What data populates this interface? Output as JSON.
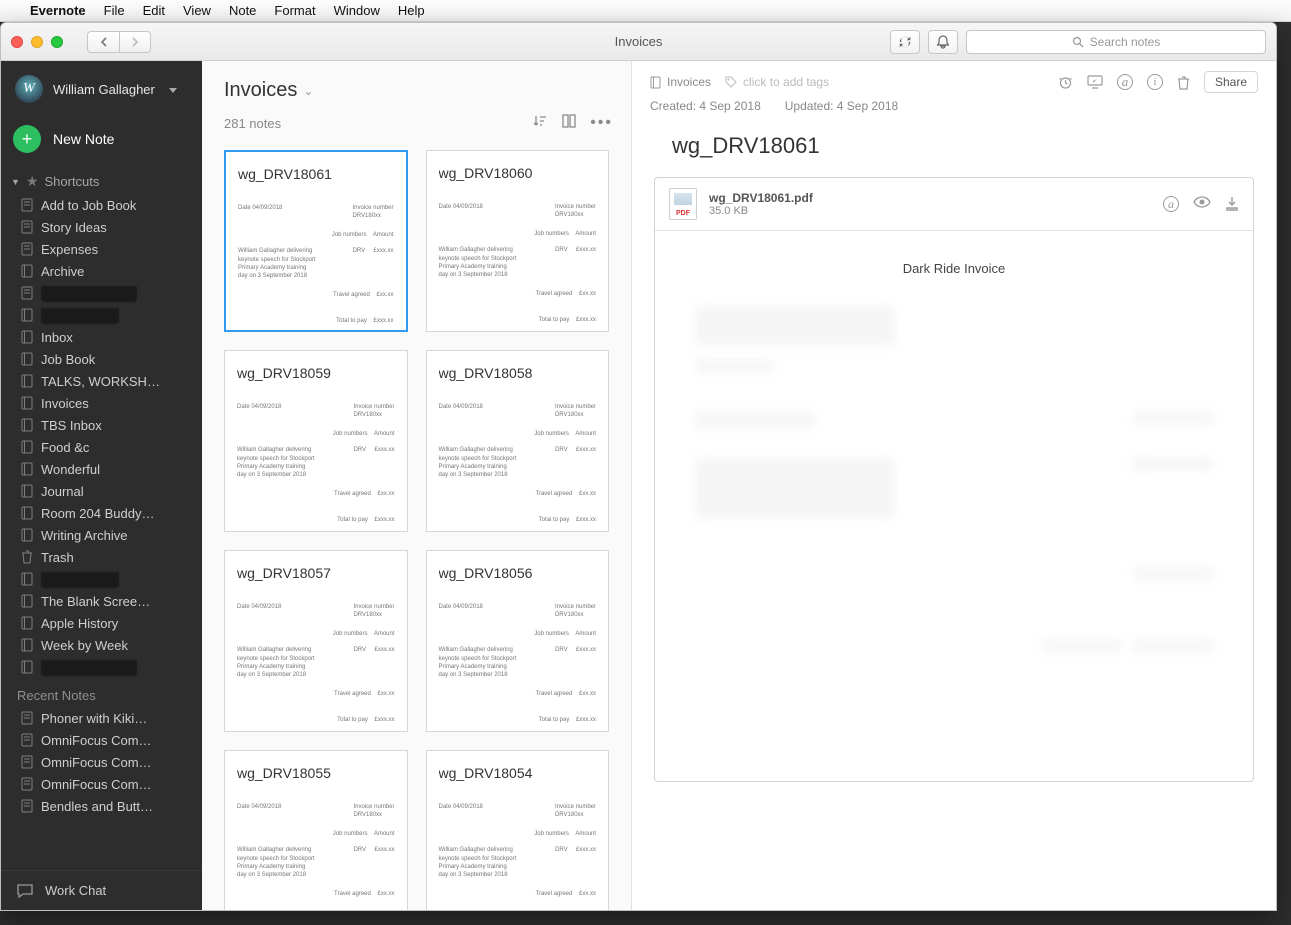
{
  "menubar": {
    "app": "Evernote",
    "items": [
      "File",
      "Edit",
      "View",
      "Note",
      "Format",
      "Window",
      "Help"
    ]
  },
  "window": {
    "title": "Invoices",
    "search_placeholder": "Search notes"
  },
  "sidebar": {
    "user": "William Gallagher",
    "new_note": "New Note",
    "shortcuts_label": "Shortcuts",
    "shortcuts": [
      {
        "label": "Add to Job Book",
        "icon": "note"
      },
      {
        "label": "Story Ideas",
        "icon": "note"
      },
      {
        "label": "Expenses",
        "icon": "note"
      },
      {
        "label": "Archive",
        "icon": "notebook"
      },
      {
        "label": "██████████",
        "icon": "note",
        "redacted": true
      },
      {
        "label": "████████",
        "icon": "notebook",
        "redacted": true
      },
      {
        "label": "Inbox",
        "icon": "notebook"
      },
      {
        "label": "Job Book",
        "icon": "notebook"
      },
      {
        "label": "TALKS, WORKSH…",
        "icon": "notebook"
      },
      {
        "label": "Invoices",
        "icon": "notebook"
      },
      {
        "label": "TBS Inbox",
        "icon": "notebook"
      },
      {
        "label": "Food &c",
        "icon": "notebook"
      },
      {
        "label": "Wonderful",
        "icon": "notebook"
      },
      {
        "label": "Journal",
        "icon": "notebook"
      },
      {
        "label": "Room 204 Buddy…",
        "icon": "notebook"
      },
      {
        "label": "Writing Archive",
        "icon": "notebook"
      },
      {
        "label": "Trash",
        "icon": "trash"
      },
      {
        "label": "████████",
        "icon": "notebook",
        "redacted": true
      },
      {
        "label": "The Blank Scree…",
        "icon": "notebook"
      },
      {
        "label": "Apple History",
        "icon": "notebook"
      },
      {
        "label": "Week by Week",
        "icon": "notebook"
      },
      {
        "label": "██████████",
        "icon": "notebook",
        "redacted": true
      }
    ],
    "recent_label": "Recent Notes",
    "recent": [
      {
        "label": "Phoner with Kiki…"
      },
      {
        "label": "OmniFocus Com…"
      },
      {
        "label": "OmniFocus Com…"
      },
      {
        "label": "OmniFocus Com…"
      },
      {
        "label": "Bendles and Butt…"
      }
    ],
    "workchat": "Work Chat"
  },
  "notelist": {
    "title": "Invoices",
    "count": "281 notes",
    "cards": [
      {
        "title": "wg_DRV18061",
        "selected": true
      },
      {
        "title": "wg_DRV18060"
      },
      {
        "title": "wg_DRV18059"
      },
      {
        "title": "wg_DRV18058"
      },
      {
        "title": "wg_DRV18057"
      },
      {
        "title": "wg_DRV18056"
      },
      {
        "title": "wg_DRV18055"
      },
      {
        "title": "wg_DRV18054"
      }
    ]
  },
  "detail": {
    "notebook": "Invoices",
    "tags_placeholder": "click to add tags",
    "share": "Share",
    "created": "Created: 4 Sep 2018",
    "updated": "Updated: 4 Sep 2018",
    "title": "wg_DRV18061",
    "attachment": {
      "name": "wg_DRV18061.pdf",
      "size": "35.0 KB",
      "badge": "PDF"
    },
    "invoice_title": "Dark Ride Invoice"
  }
}
